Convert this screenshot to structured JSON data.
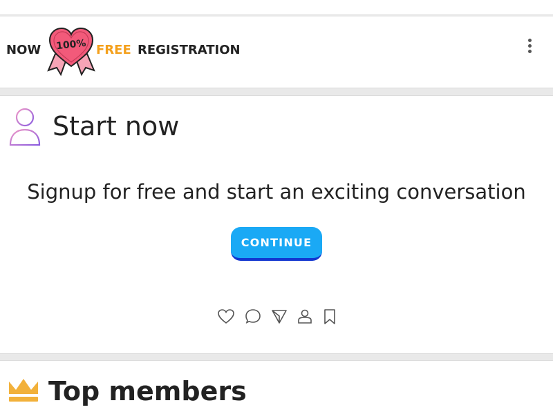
{
  "promo": {
    "now": "NOW",
    "badge_text": "100%",
    "free": "FREE",
    "registration": "REGISTRATION"
  },
  "card": {
    "title": "Start now",
    "subtitle": "Signup for free and start an exciting conversation",
    "continue_label": "CONTINUE"
  },
  "actions": [
    {
      "icon": "heart-icon"
    },
    {
      "icon": "comment-icon"
    },
    {
      "icon": "send-icon"
    },
    {
      "icon": "user-icon"
    },
    {
      "icon": "bookmark-icon"
    }
  ],
  "section2": {
    "title": "Top members"
  },
  "colors": {
    "accent_orange": "#f4a01c",
    "button_blue": "#1aa9f5",
    "button_border": "#1236d0",
    "badge_pink": "#f25a7a",
    "icon_purple": "#a46be0",
    "crown_gold": "#f2b13b"
  }
}
